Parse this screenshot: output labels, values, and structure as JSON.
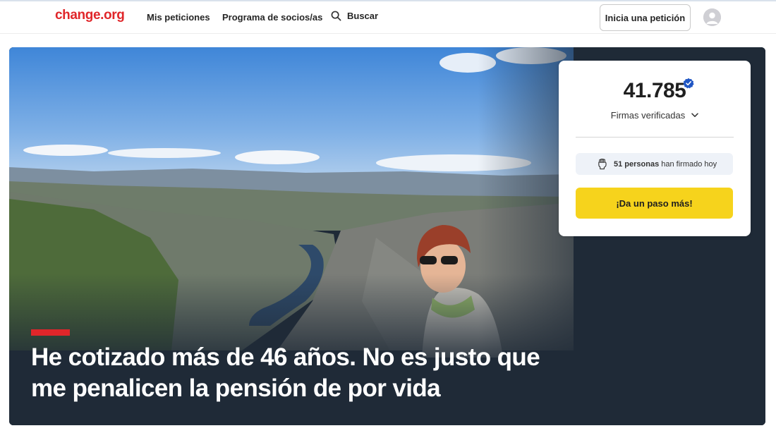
{
  "nav": {
    "logo": "change.org",
    "logo_color": "#e0262a",
    "links": [
      "Mis peticiones",
      "Programa de socios/as"
    ],
    "search_label": "Buscar",
    "start_button": "Inicia una petición"
  },
  "hero": {
    "title": "He cotizado más de 46 años. No es justo que me penalicen la pensión de por vida",
    "accent_color": "#e0262a"
  },
  "signatures": {
    "count": "41.785",
    "label": "Firmas verificadas",
    "today_count": "51 personas",
    "today_text": " han firmado hoy",
    "cta": "¡Da un paso más!",
    "cta_color": "#f6d31c"
  },
  "icons": [
    "search-icon",
    "user-avatar-icon",
    "verified-check-icon",
    "chevron-down-icon",
    "raised-fist-icon"
  ]
}
